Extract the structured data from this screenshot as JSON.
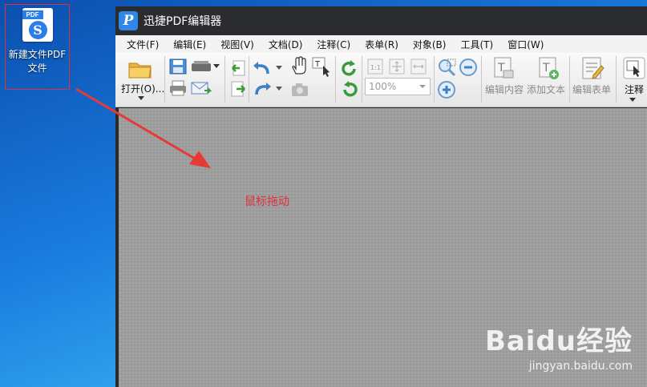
{
  "desktop_icon": {
    "tag": "PDF",
    "logo_letter": "S",
    "label_line1": "新建文件PDF",
    "label_line2": "文件"
  },
  "window": {
    "logo_letter": "P",
    "title": "迅捷PDF编辑器"
  },
  "menu": [
    "文件(F)",
    "编辑(E)",
    "视图(V)",
    "文档(D)",
    "注释(C)",
    "表单(R)",
    "对象(B)",
    "工具(T)",
    "窗口(W)"
  ],
  "toolbar": {
    "open_label": "打开(O)...",
    "zoom_value": "100%",
    "edit_content_label": "编辑内容",
    "add_text_label": "添加文本",
    "edit_form_label": "编辑表单",
    "annotate_label": "注释"
  },
  "workspace": {
    "annotation": "鼠标拖动"
  },
  "watermark": {
    "brand": "Baidu经验",
    "url": "jingyan.baidu.com"
  },
  "colors": {
    "annotation_red": "#e0303a",
    "app_blue": "#2f87e8",
    "titlebar": "#2b2c30"
  }
}
